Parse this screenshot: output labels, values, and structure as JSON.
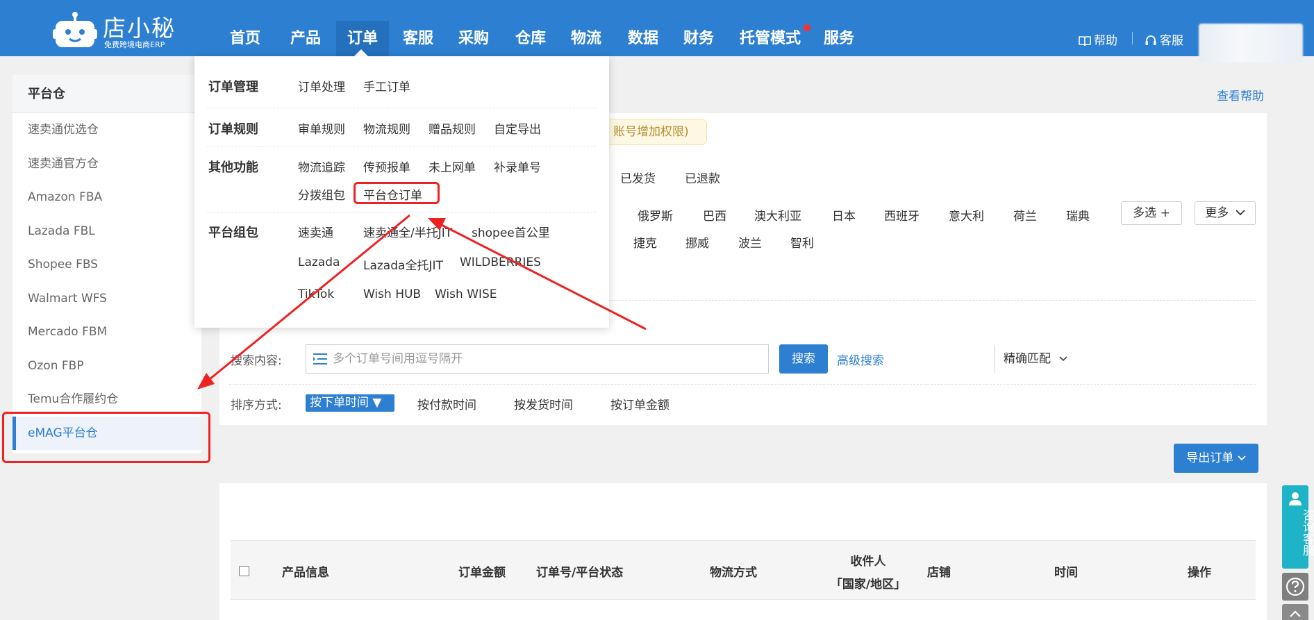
{
  "brand": {
    "name": "店小秘",
    "tagline": "免费跨境电商ERP"
  },
  "nav": {
    "items": [
      "首页",
      "产品",
      "订单",
      "客服",
      "采购",
      "仓库",
      "物流",
      "数据",
      "财务",
      "托管模式",
      "服务"
    ]
  },
  "topright": {
    "help": "帮助",
    "service": "客服"
  },
  "sidebar": {
    "title": "平台仓",
    "items": [
      "速卖通优选仓",
      "速卖通官方仓",
      "Amazon FBA",
      "Lazada FBL",
      "Shopee FBS",
      "Walmart WFS",
      "Mercado FBM",
      "Ozon FBP",
      "Temu合作履约仓",
      "eMAG平台仓"
    ]
  },
  "main": {
    "help_link": "查看帮助",
    "notice": "账号增加权限)",
    "status_tabs": [
      "已发货",
      "已退款"
    ],
    "countries_row1": [
      "俄罗斯",
      "巴西",
      "澳大利亚",
      "日本",
      "西班牙",
      "意大利",
      "荷兰",
      "瑞典"
    ],
    "countries_row2": [
      "捷克",
      "挪威",
      "波兰",
      "智利"
    ],
    "multi_select": "多选 +",
    "more": "更多",
    "search_label": "搜索内容:",
    "search_placeholder": "多个订单号间用逗号隔开",
    "match_mode": "精确匹配",
    "search_button": "搜索",
    "advanced_search": "高级搜索",
    "sort_label": "排序方式:",
    "sort_active": "按下单时间 ▼",
    "sort_options": [
      "按付款时间",
      "按发货时间",
      "按订单金额"
    ],
    "export_button": "导出订单",
    "table_headers": {
      "product": "产品信息",
      "amount": "订单金额",
      "order_no": "订单号/平台状态",
      "logistics": "物流方式",
      "recipient_1": "收件人",
      "recipient_2": "「国家/地区」",
      "store": "店铺",
      "time": "时间",
      "ops": "操作"
    }
  },
  "floating": {
    "consult": "咨询客服"
  },
  "dropdown": {
    "groups": [
      {
        "title": "订单管理",
        "items": [
          "订单处理",
          "手工订单"
        ]
      },
      {
        "title": "订单规则",
        "items": [
          "审单规则",
          "物流规则",
          "赠品规则",
          "自定导出"
        ]
      },
      {
        "title": "其他功能",
        "items": [
          "物流追踪",
          "传预报单",
          "未上网单",
          "补录单号",
          "分拨组包",
          "平台仓订单"
        ]
      },
      {
        "title": "平台组包",
        "items": [
          "速卖通",
          "速卖通全/半托JIT",
          "shopee首公里",
          "Lazada",
          "Lazada全托JIT",
          "WILDBERRIES",
          "TikTok",
          "Wish HUB",
          "Wish WISE"
        ]
      }
    ]
  },
  "colors": {
    "brand_blue": "#2d7fd1",
    "highlight_red": "#ee2222",
    "cs_teal": "#1fb3c8"
  }
}
